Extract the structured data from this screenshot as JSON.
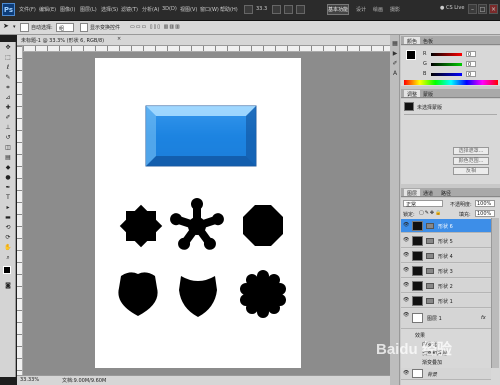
{
  "app": {
    "logo": "Ps",
    "menus": [
      "文件(F)",
      "编辑(E)",
      "图像(I)",
      "图层(L)",
      "选择(S)",
      "滤镜(T)",
      "分析(A)",
      "3D(D)",
      "视图(V)",
      "窗口(W)",
      "帮助(H)"
    ],
    "zoom": "33.3",
    "workspaces": [
      "基本功能",
      "设计",
      "绘画",
      "摄影"
    ],
    "workspace_active": "基本功能",
    "cs_live": "CS Live",
    "win_min": "–",
    "win_max": "□",
    "win_close": "×"
  },
  "options": {
    "tool_label": "形状:",
    "mode": "径",
    "auto_select": "自动选择:",
    "auto_select_value": "组",
    "show_transform": "显示变换控件"
  },
  "document": {
    "tab_title": "未标题-1 @ 33.3% (形状 6, RGB/8)",
    "status_zoom": "33.33%",
    "status_doc": "文档:9.00M/9.60M"
  },
  "panels": {
    "color_tabs": [
      "颜色",
      "色板"
    ],
    "color_labels": [
      "R",
      "G",
      "B"
    ],
    "color_values": [
      "0",
      "0",
      "0"
    ],
    "adjust_tabs": [
      "调整",
      "蒙版"
    ],
    "adjust_item": "未选择蒙版",
    "adjust_buttons": [
      "选择遮罩...",
      "颜色范围...",
      "反相"
    ],
    "layers_tabs": [
      "图层",
      "通道",
      "路径"
    ],
    "blend_mode": "正常",
    "opacity_label": "不透明度:",
    "opacity_value": "100%",
    "lock_label": "锁定:",
    "fill_label": "填充:",
    "fill_value": "100%",
    "layers": [
      {
        "name": "形状 6",
        "selected": true
      },
      {
        "name": "形状 5",
        "selected": false
      },
      {
        "name": "形状 4",
        "selected": false
      },
      {
        "name": "形状 3",
        "selected": false
      },
      {
        "name": "形状 2",
        "selected": false
      },
      {
        "name": "形状 1",
        "selected": false
      },
      {
        "name": "图层 1",
        "selected": false
      }
    ],
    "effects_label": "效果",
    "effect_items": [
      "内发光",
      "斜面和浮雕",
      "渐变叠加"
    ],
    "bg_layer": "背景"
  },
  "watermark": "Baidu 经验"
}
